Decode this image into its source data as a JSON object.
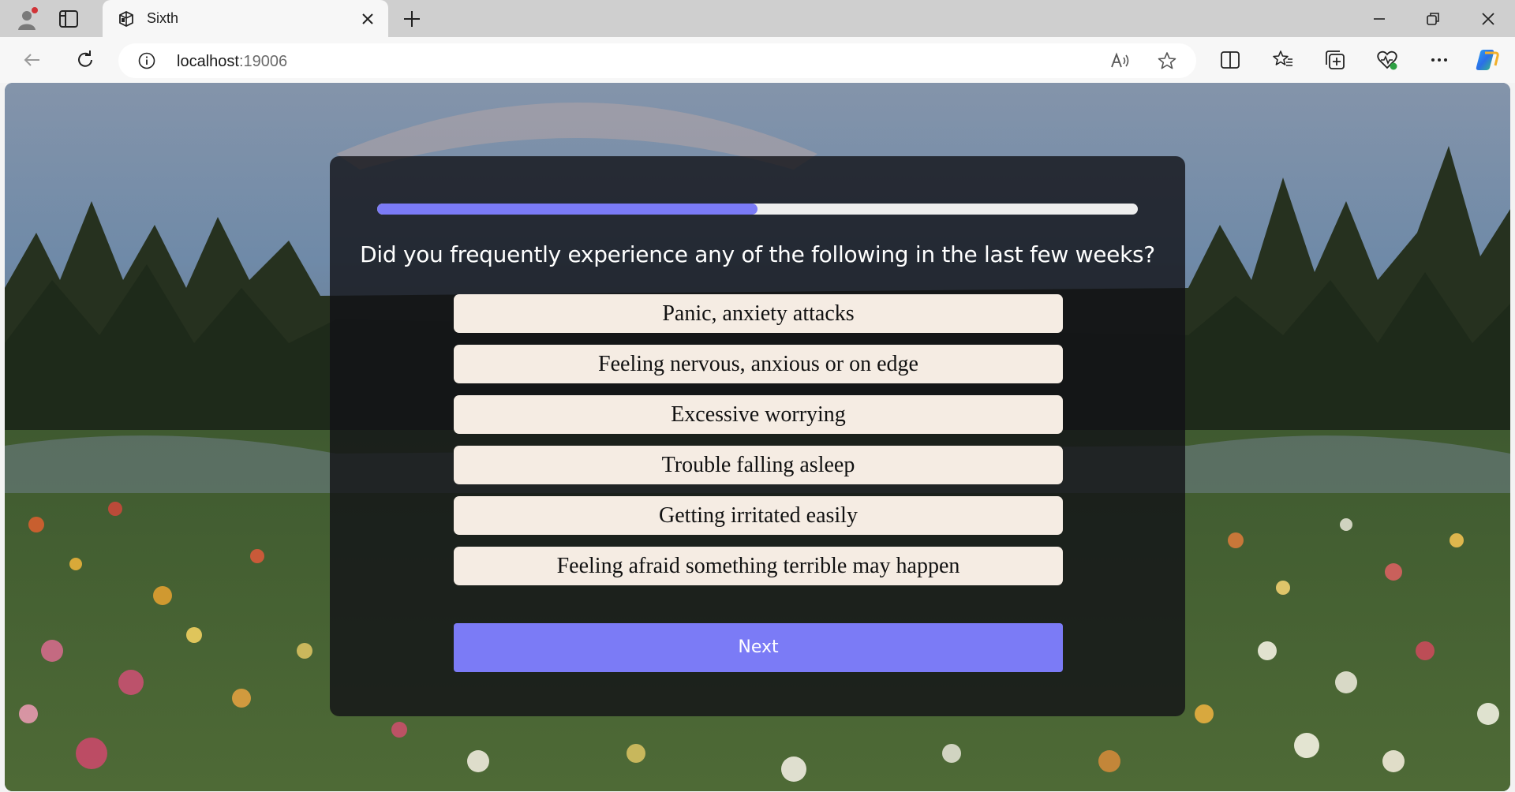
{
  "browser": {
    "tab_title": "Sixth",
    "url_host": "localhost",
    "url_port": ":19006"
  },
  "quiz": {
    "progress_fraction": 0.5,
    "question": "Did you frequently experience any of the following in the last few weeks?",
    "options": [
      "Panic, anxiety attacks",
      "Feeling nervous, anxious or on edge",
      "Excessive worrying",
      "Trouble falling asleep",
      "Getting irritated easily",
      "Feeling afraid something terrible may happen"
    ],
    "next_label": "Next"
  },
  "colors": {
    "accent": "#7b7bf6",
    "option_bg": "#f5ece3",
    "card_bg": "rgba(18,18,22,0.80)"
  }
}
